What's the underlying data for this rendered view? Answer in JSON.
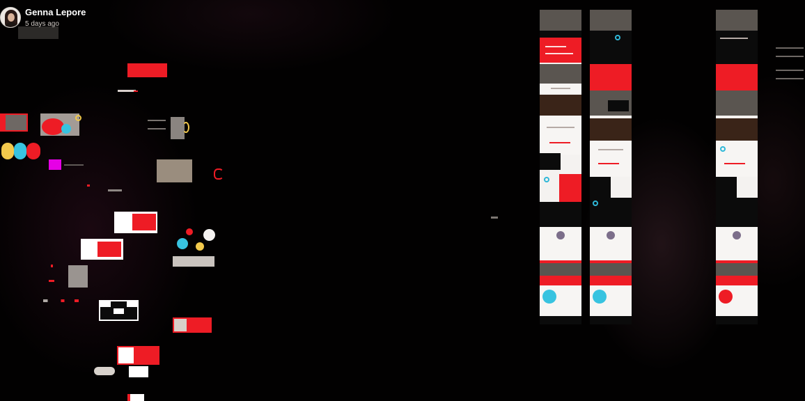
{
  "post": {
    "author": "Genna Lepore",
    "time": "5 days ago"
  },
  "colors": {
    "accent_red": "#ee1c25",
    "cyan": "#38c3e0",
    "yellow": "#f2c94c",
    "magenta": "#e600e6",
    "background": "#020101"
  },
  "icons": {
    "avatar": "person-portrait"
  },
  "canvas": {
    "description_none": ""
  }
}
